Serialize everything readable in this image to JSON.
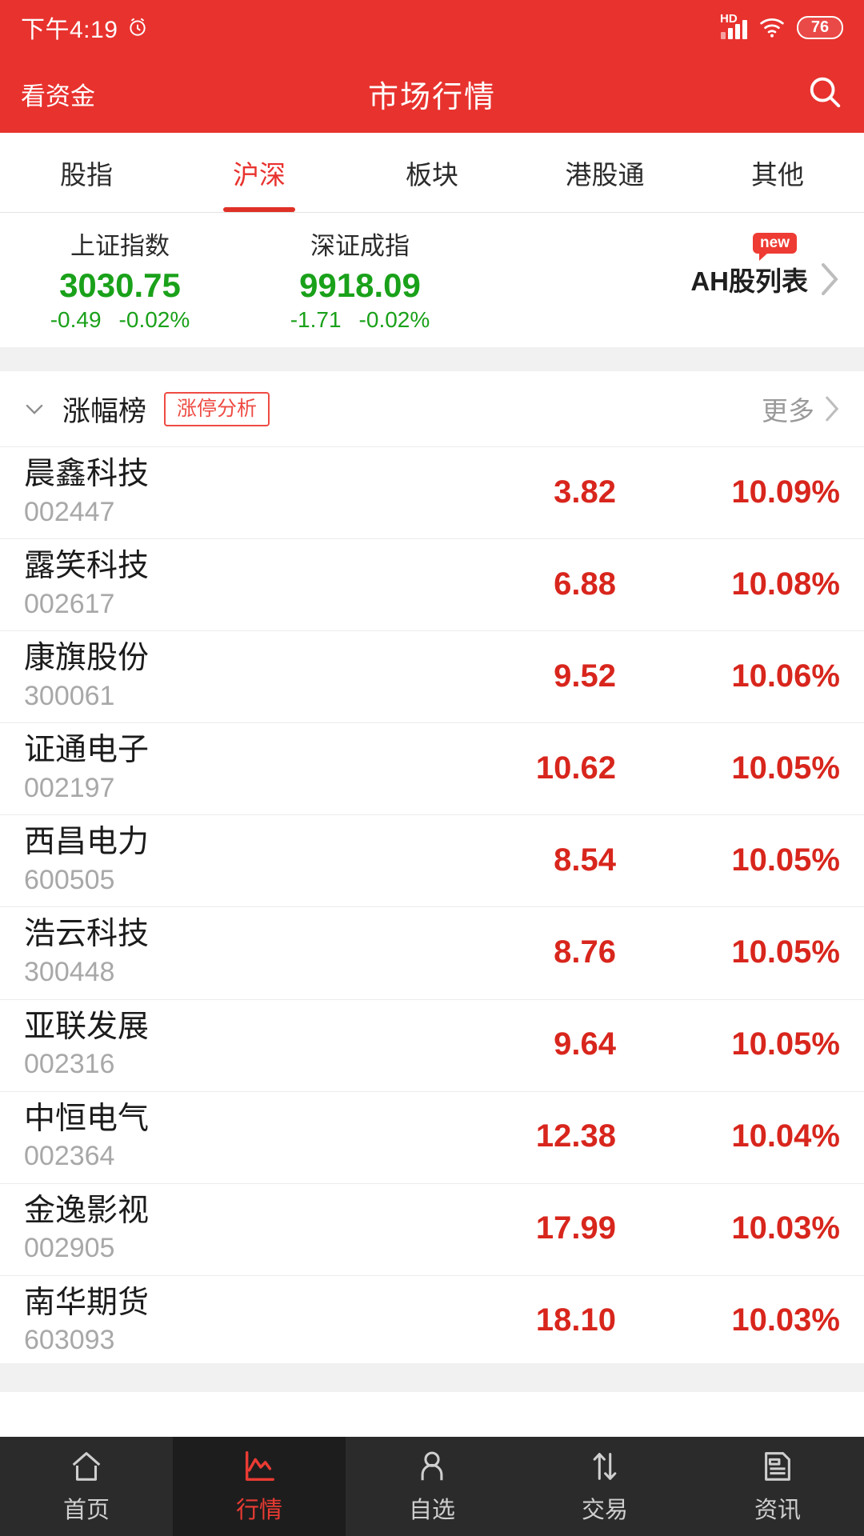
{
  "status_bar": {
    "time": "下午4:19",
    "alarm_icon": "alarm-clock-icon",
    "network_label": "HD",
    "signal_icon": "cellular-signal-icon",
    "wifi_icon": "wifi-icon",
    "battery_level": "76"
  },
  "app_bar": {
    "left_action": "看资金",
    "title": "市场行情",
    "search_icon": "search-icon"
  },
  "tabs": [
    {
      "label": "股指",
      "active": false
    },
    {
      "label": "沪深",
      "active": true
    },
    {
      "label": "板块",
      "active": false
    },
    {
      "label": "港股通",
      "active": false
    },
    {
      "label": "其他",
      "active": false
    }
  ],
  "indices": [
    {
      "name": "上证指数",
      "value": "3030.75",
      "change": "-0.49",
      "change_pct": "-0.02%",
      "direction": "down"
    },
    {
      "name": "深证成指",
      "value": "9918.09",
      "change": "-1.71",
      "change_pct": "-0.02%",
      "direction": "down"
    }
  ],
  "ah_entry": {
    "badge": "new",
    "label": "AH股列表",
    "chevron_icon": "chevron-right-icon"
  },
  "section": {
    "caret_icon": "chevron-down-icon",
    "title": "涨幅榜",
    "pill_label": "涨停分析",
    "more_label": "更多",
    "more_chevron_icon": "chevron-right-icon"
  },
  "stocks": [
    {
      "name": "晨鑫科技",
      "code": "002447",
      "price": "3.82",
      "change_pct": "10.09%"
    },
    {
      "name": "露笑科技",
      "code": "002617",
      "price": "6.88",
      "change_pct": "10.08%"
    },
    {
      "name": "康旗股份",
      "code": "300061",
      "price": "9.52",
      "change_pct": "10.06%"
    },
    {
      "name": "证通电子",
      "code": "002197",
      "price": "10.62",
      "change_pct": "10.05%"
    },
    {
      "name": "西昌电力",
      "code": "600505",
      "price": "8.54",
      "change_pct": "10.05%"
    },
    {
      "name": "浩云科技",
      "code": "300448",
      "price": "8.76",
      "change_pct": "10.05%"
    },
    {
      "name": "亚联发展",
      "code": "002316",
      "price": "9.64",
      "change_pct": "10.05%"
    },
    {
      "name": "中恒电气",
      "code": "002364",
      "price": "12.38",
      "change_pct": "10.04%"
    },
    {
      "name": "金逸影视",
      "code": "002905",
      "price": "17.99",
      "change_pct": "10.03%"
    },
    {
      "name": "南华期货",
      "code": "603093",
      "price": "18.10",
      "change_pct": "10.03%"
    }
  ],
  "bottom_nav": [
    {
      "label": "首页",
      "icon": "home-icon",
      "active": false
    },
    {
      "label": "行情",
      "icon": "chart-icon",
      "active": true
    },
    {
      "label": "自选",
      "icon": "person-icon",
      "active": false
    },
    {
      "label": "交易",
      "icon": "transfer-icon",
      "active": false
    },
    {
      "label": "资讯",
      "icon": "news-icon",
      "active": false
    }
  ],
  "colors": {
    "brand_red": "#e8322e",
    "up_red": "#d8261d",
    "down_green": "#1aa11a",
    "muted_gray": "#a8a8a8"
  }
}
